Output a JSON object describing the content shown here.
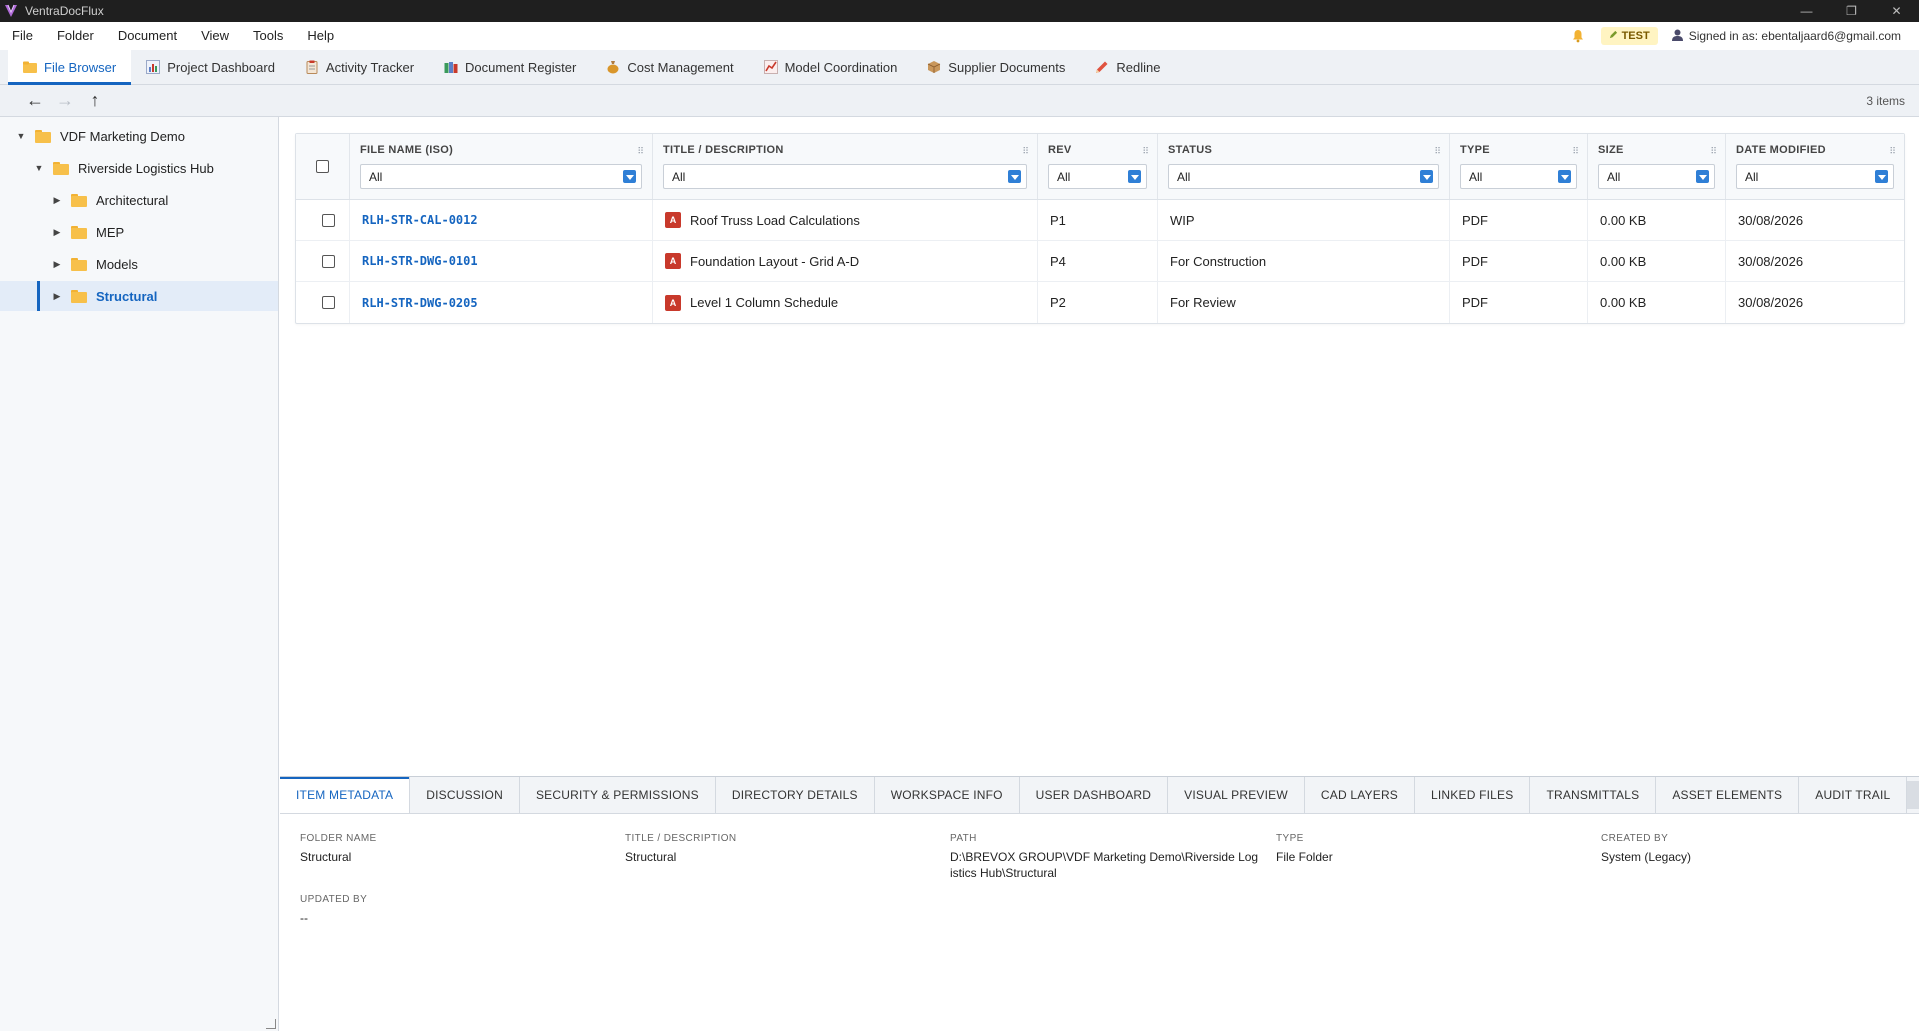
{
  "app": {
    "title": "VentraDocFlux",
    "window_controls": {
      "minimize": "—",
      "restore": "❐",
      "close": "✕"
    }
  },
  "menu": {
    "items": [
      "File",
      "Folder",
      "Document",
      "View",
      "Tools",
      "Help"
    ],
    "badge": "TEST",
    "signed_in": "Signed in as: ebentaljaard6@gmail.com"
  },
  "tabs": [
    {
      "label": "File Browser",
      "icon": "folder-icon",
      "color": "#f7c04a"
    },
    {
      "label": "Project Dashboard",
      "icon": "bar-chart-icon",
      "color": "#5b7fc7"
    },
    {
      "label": "Activity Tracker",
      "icon": "clipboard-icon",
      "color": "#c8392b"
    },
    {
      "label": "Document Register",
      "icon": "books-icon",
      "color": "#3a9a5b"
    },
    {
      "label": "Cost Management",
      "icon": "money-bag-icon",
      "color": "#d9962b"
    },
    {
      "label": "Model Coordination",
      "icon": "chart-icon",
      "color": "#c8392b"
    },
    {
      "label": "Supplier Documents",
      "icon": "package-icon",
      "color": "#b07b3f"
    },
    {
      "label": "Redline",
      "icon": "pencil-icon",
      "color": "#e0533f"
    }
  ],
  "toolbar": {
    "back": "←",
    "forward": "→",
    "up": "↑",
    "items_count": "3 items"
  },
  "tree": [
    {
      "label": "VDF Marketing Demo",
      "toggle": "▼"
    },
    {
      "label": "Riverside Logistics Hub",
      "toggle": "▼"
    },
    {
      "label": "Architectural",
      "toggle": "▶"
    },
    {
      "label": "MEP",
      "toggle": "▶"
    },
    {
      "label": "Models",
      "toggle": "▶"
    },
    {
      "label": "Structural",
      "toggle": "▶"
    }
  ],
  "grid": {
    "columns": [
      "FILE NAME (ISO)",
      "TITLE / DESCRIPTION",
      "REV",
      "STATUS",
      "TYPE",
      "SIZE",
      "DATE MODIFIED"
    ],
    "filters": [
      "All",
      "All",
      "All",
      "All",
      "All",
      "All",
      "All"
    ],
    "rows": [
      {
        "file": "RLH-STR-CAL-0012",
        "title": "Roof Truss Load Calculations",
        "rev": "P1",
        "status": "WIP",
        "type": "PDF",
        "size": "0.00 KB",
        "date": "30/08/2026"
      },
      {
        "file": "RLH-STR-DWG-0101",
        "title": "Foundation Layout - Grid A-D",
        "rev": "P4",
        "status": "For Construction",
        "type": "PDF",
        "size": "0.00 KB",
        "date": "30/08/2026"
      },
      {
        "file": "RLH-STR-DWG-0205",
        "title": "Level 1 Column Schedule",
        "rev": "P2",
        "status": "For Review",
        "type": "PDF",
        "size": "0.00 KB",
        "date": "30/08/2026"
      }
    ],
    "pdf_icon_letter": "A"
  },
  "bottom_tabs": [
    "ITEM METADATA",
    "DISCUSSION",
    "SECURITY & PERMISSIONS",
    "DIRECTORY DETAILS",
    "WORKSPACE INFO",
    "USER DASHBOARD",
    "VISUAL PREVIEW",
    "CAD LAYERS",
    "LINKED FILES",
    "TRANSMITTALS",
    "ASSET ELEMENTS",
    "AUDIT TRAIL"
  ],
  "metadata": {
    "folder_name_label": "FOLDER NAME",
    "folder_name": "Structural",
    "title_label": "TITLE / DESCRIPTION",
    "title": "Structural",
    "path_label": "PATH",
    "path": "D:\\BREVOX GROUP\\VDF Marketing Demo\\Riverside Logistics Hub\\Structural",
    "type_label": "TYPE",
    "type": "File Folder",
    "created_by_label": "CREATED BY",
    "created_by": "System (Legacy)",
    "updated_by_label": "UPDATED BY",
    "updated_by": "--"
  }
}
